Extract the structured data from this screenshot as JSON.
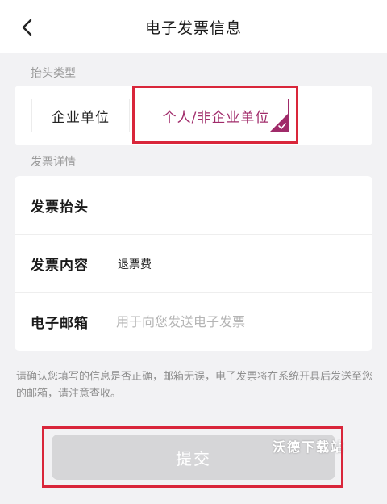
{
  "header": {
    "title": "电子发票信息",
    "back_icon": "chevron-left-icon"
  },
  "invoice_type": {
    "section_label": "抬头类型",
    "options": [
      {
        "label": "企业单位",
        "selected": false
      },
      {
        "label": "个人/非企业单位",
        "selected": true
      }
    ],
    "selected_icon": "check-corner-icon"
  },
  "details": {
    "section_label": "发票详情",
    "title_row": {
      "label": "发票抬头",
      "value": ""
    },
    "content_row": {
      "label": "发票内容",
      "value": "退票费"
    },
    "email_row": {
      "label": "电子邮箱",
      "value": "",
      "placeholder": "用于向您发送电子发票"
    }
  },
  "notice": "请确认您填写的信息是否正确，邮箱无误，电子发票将在系统开具后发送至您的邮箱，请注意查收。",
  "submit": {
    "label": "提交",
    "enabled": false
  },
  "watermark": "沃德下载站",
  "colors": {
    "accent": "#a02b6a",
    "highlight": "#d9263a",
    "background": "#f2f2f4",
    "button_disabled": "#d6d6d8"
  }
}
